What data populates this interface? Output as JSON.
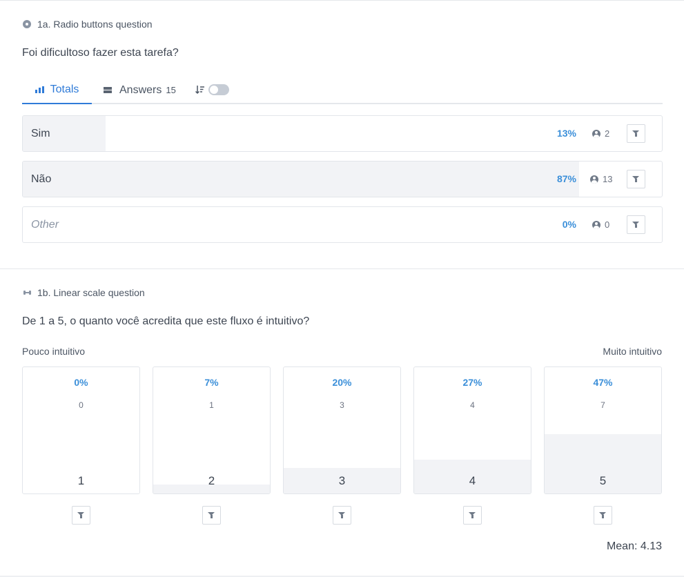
{
  "q1": {
    "type_label": "1a. Radio buttons question",
    "question": "Foi dificultoso fazer esta tarefa?",
    "tabs": {
      "totals": "Totals",
      "answers": "Answers",
      "answers_count": "15"
    },
    "sort_icon": "sort-descending-icon",
    "toggle_on": false,
    "options": [
      {
        "label": "Sim",
        "pct": "13%",
        "count": "2",
        "fraction": 0.13
      },
      {
        "label": "Não",
        "pct": "87%",
        "count": "13",
        "fraction": 0.87
      },
      {
        "label": "Other",
        "pct": "0%",
        "count": "0",
        "fraction": 0.0
      }
    ]
  },
  "q2": {
    "type_label": "1b. Linear scale question",
    "question": "De 1 a 5, o quanto você acredita que este fluxo é intuitivo?",
    "min_label": "Pouco intuitivo",
    "max_label": "Muito intuitivo",
    "scale": [
      {
        "value": "1",
        "pct": "0%",
        "count": "0",
        "fraction": 0.0
      },
      {
        "value": "2",
        "pct": "7%",
        "count": "1",
        "fraction": 0.07
      },
      {
        "value": "3",
        "pct": "20%",
        "count": "3",
        "fraction": 0.2
      },
      {
        "value": "4",
        "pct": "27%",
        "count": "4",
        "fraction": 0.27
      },
      {
        "value": "5",
        "pct": "47%",
        "count": "7",
        "fraction": 0.47
      }
    ],
    "mean": "Mean: 4.13"
  },
  "colors": {
    "accent": "#2f7bd8",
    "pct_text": "#3b8fd9",
    "bar_fill": "#f2f3f6",
    "border": "#e2e5ea"
  }
}
